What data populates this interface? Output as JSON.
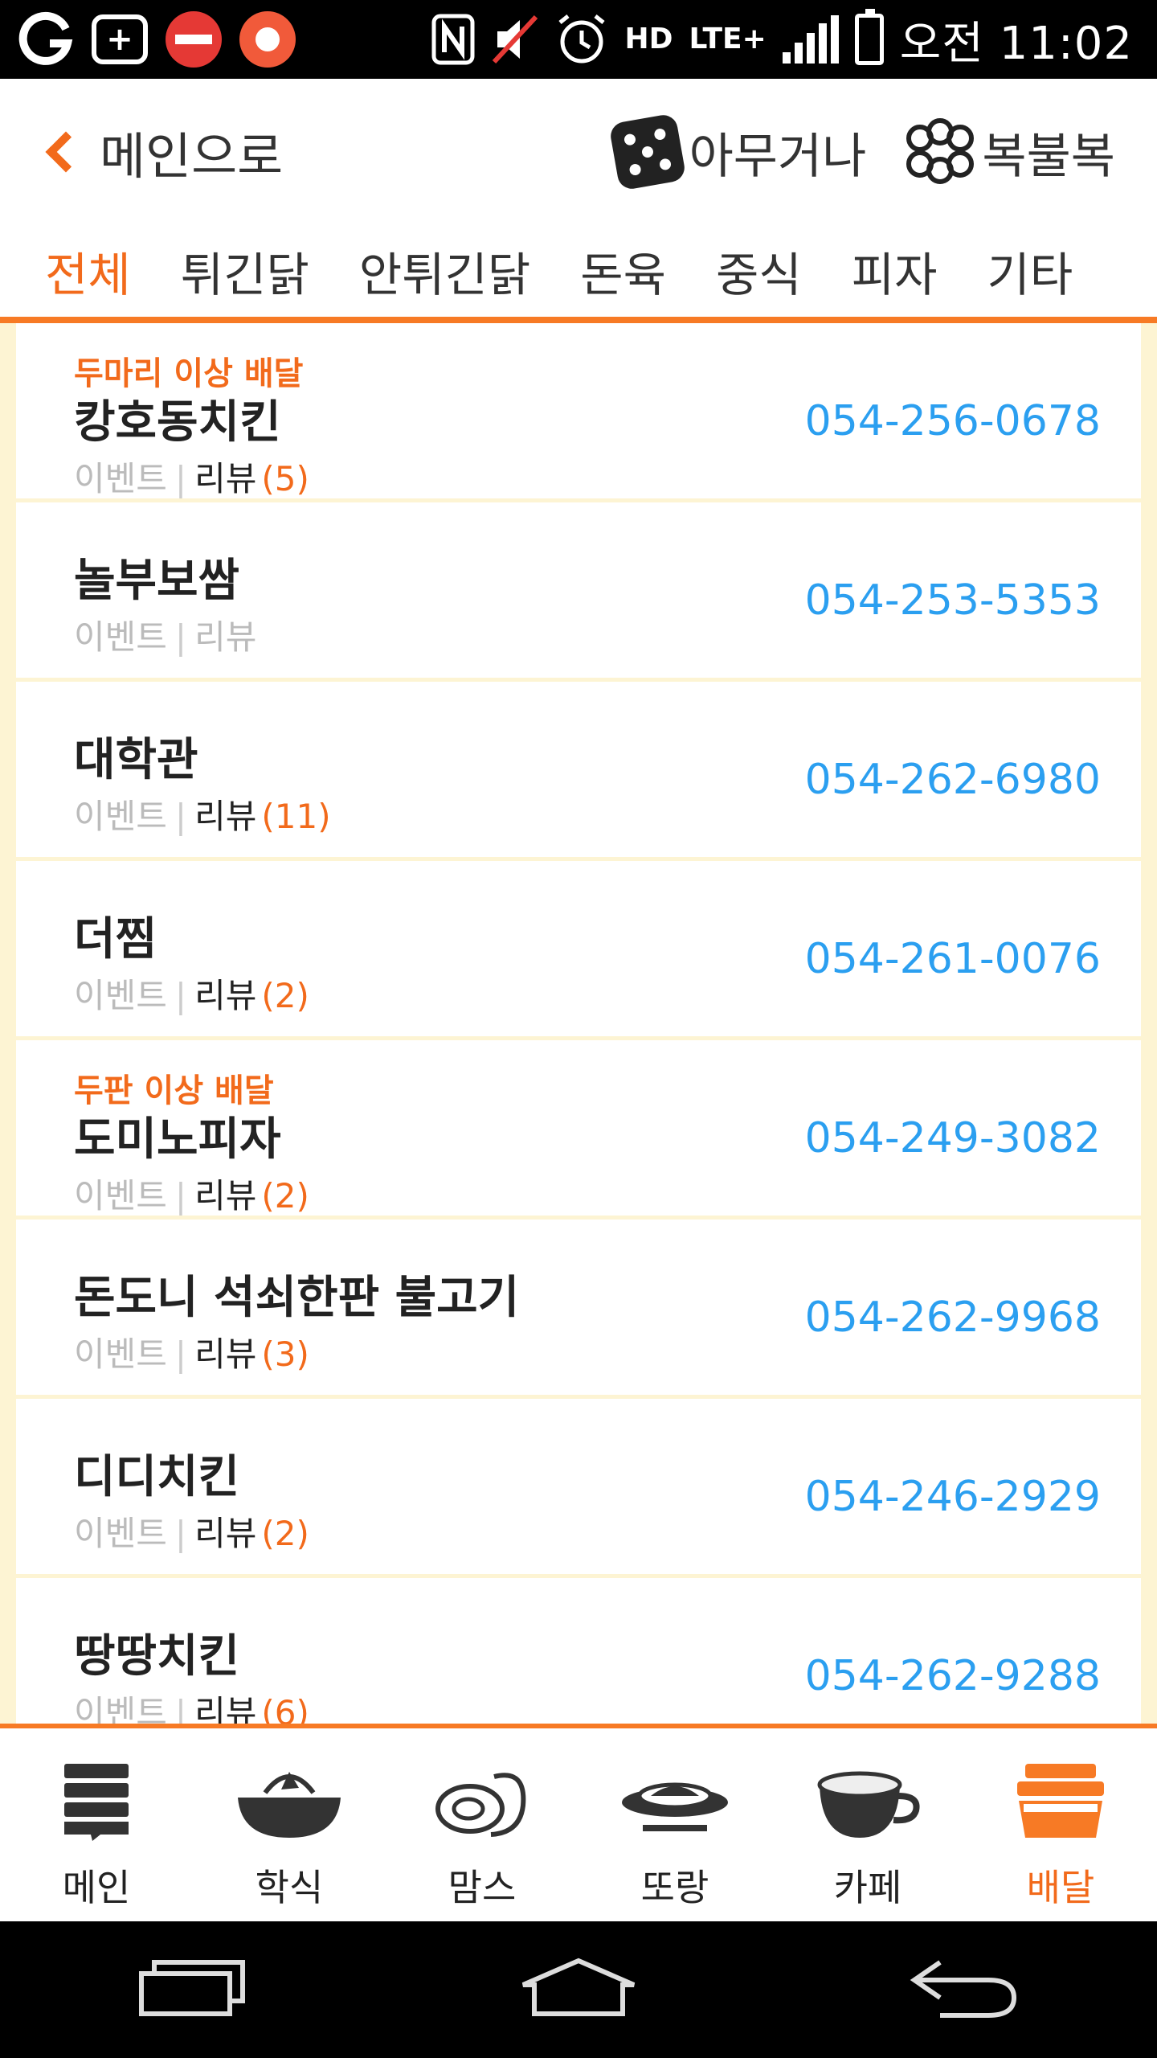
{
  "status_bar": {
    "time": "오전 11:02",
    "lte": "LTE+",
    "hd": "HD"
  },
  "header": {
    "back_label": "메인으로",
    "random_label": "아무거나",
    "lottery_label": "복불복"
  },
  "tabs": [
    {
      "label": "전체",
      "active": true
    },
    {
      "label": "튀긴닭",
      "active": false
    },
    {
      "label": "안튀긴닭",
      "active": false
    },
    {
      "label": "돈육",
      "active": false
    },
    {
      "label": "중식",
      "active": false
    },
    {
      "label": "피자",
      "active": false
    },
    {
      "label": "기타",
      "active": false
    }
  ],
  "list": {
    "meta_event_label": "이벤트",
    "meta_review_label": "리뷰",
    "items": [
      {
        "flag": "두마리 이상 배달",
        "name": "캉호동치킨",
        "review_count": "(5)",
        "phone": "054-256-0678"
      },
      {
        "flag": "",
        "name": "놀부보쌈",
        "review_count": "",
        "phone": "054-253-5353"
      },
      {
        "flag": "",
        "name": "대학관",
        "review_count": "(11)",
        "phone": "054-262-6980"
      },
      {
        "flag": "",
        "name": "더찜",
        "review_count": "(2)",
        "phone": "054-261-0076"
      },
      {
        "flag": "두판 이상 배달",
        "name": "도미노피자",
        "review_count": "(2)",
        "phone": "054-249-3082"
      },
      {
        "flag": "",
        "name": "돈도니 석쇠한판 불고기",
        "review_count": "(3)",
        "phone": "054-262-9968"
      },
      {
        "flag": "",
        "name": "디디치킨",
        "review_count": "(2)",
        "phone": "054-246-2929"
      },
      {
        "flag": "",
        "name": "땅땅치킨",
        "review_count": "(6)",
        "phone": "054-262-9288"
      }
    ]
  },
  "bottom_nav": [
    {
      "label": "메인",
      "icon": "menu-stack-icon",
      "active": false
    },
    {
      "label": "학식",
      "icon": "rice-bowl-icon",
      "active": false
    },
    {
      "label": "맘스",
      "icon": "mom-face-icon",
      "active": false
    },
    {
      "label": "또랑",
      "icon": "plate-icon",
      "active": false
    },
    {
      "label": "카페",
      "icon": "coffee-cup-icon",
      "active": false
    },
    {
      "label": "배달",
      "icon": "delivery-box-icon",
      "active": true
    }
  ],
  "colors": {
    "accent": "#f26a1b",
    "phone": "#2b9ff0",
    "list_bg": "#fdf4d3"
  }
}
